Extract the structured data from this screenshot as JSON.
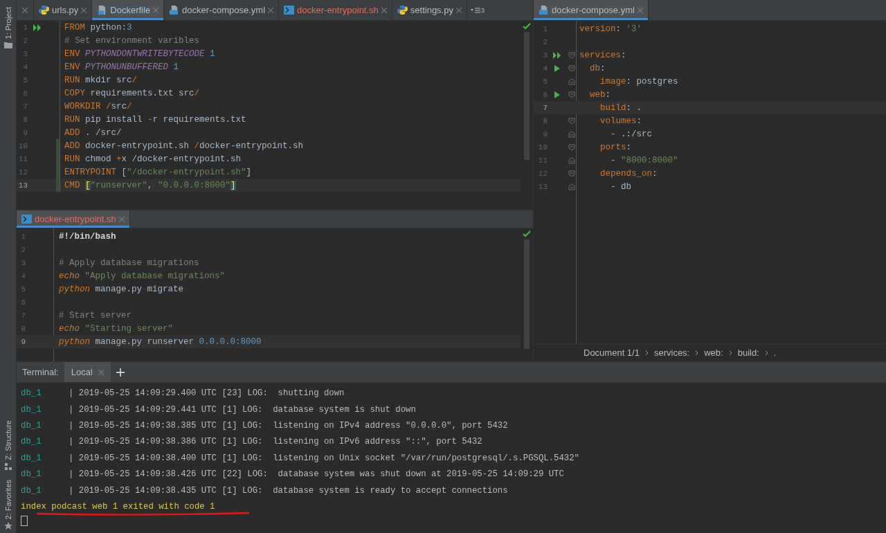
{
  "sidebar": {
    "top": [
      {
        "label": "1: Project"
      }
    ],
    "bottom": [
      {
        "label": "Z: Structure"
      },
      {
        "label": "2: Favorites"
      }
    ]
  },
  "editors": [
    {
      "kind": "dockerfile",
      "tabs": [
        {
          "label": "urls.py",
          "kind": "python",
          "selected": false,
          "error": false
        },
        {
          "label": "Dockerfile",
          "kind": "docker",
          "selected": true,
          "error": false
        },
        {
          "label": "docker-compose.yml",
          "kind": "compose",
          "selected": false,
          "error": false
        },
        {
          "label": "docker-entrypoint.sh",
          "kind": "shell",
          "selected": false,
          "error": true
        },
        {
          "label": "settings.py",
          "kind": "python",
          "selected": false,
          "error": false
        }
      ],
      "hidden_tab_count": "3",
      "lines": [
        {
          "n": "1",
          "run_all": true,
          "changed": false,
          "current": false,
          "tokens": [
            {
              "kind": "kw",
              "text": "FROM"
            },
            {
              "kind": "plain",
              "text": " python:"
            },
            {
              "kind": "num",
              "text": "3"
            }
          ]
        },
        {
          "n": "2",
          "run_all": false,
          "changed": false,
          "current": false,
          "tokens": [
            {
              "kind": "comment",
              "text": "# Set environment varibles"
            }
          ]
        },
        {
          "n": "3",
          "run_all": false,
          "changed": false,
          "current": false,
          "tokens": [
            {
              "kind": "kw",
              "text": "ENV "
            },
            {
              "kind": "var",
              "text": "PYTHONDONTWRITEBYTECODE"
            },
            {
              "kind": "num",
              "text": " 1"
            }
          ]
        },
        {
          "n": "4",
          "run_all": false,
          "changed": false,
          "current": false,
          "tokens": [
            {
              "kind": "kw",
              "text": "ENV "
            },
            {
              "kind": "var",
              "text": "PYTHONUNBUFFERED"
            },
            {
              "kind": "num",
              "text": " 1"
            }
          ]
        },
        {
          "n": "5",
          "run_all": false,
          "changed": false,
          "current": false,
          "tokens": [
            {
              "kind": "kw",
              "text": "RUN"
            },
            {
              "kind": "plain",
              "text": " mkdir src"
            },
            {
              "kind": "kw",
              "text": "/"
            }
          ]
        },
        {
          "n": "6",
          "run_all": false,
          "changed": false,
          "current": false,
          "tokens": [
            {
              "kind": "kw",
              "text": "COPY"
            },
            {
              "kind": "plain",
              "text": " requirements.txt src"
            },
            {
              "kind": "kw",
              "text": "/"
            }
          ]
        },
        {
          "n": "7",
          "run_all": false,
          "changed": false,
          "current": false,
          "tokens": [
            {
              "kind": "kw",
              "text": "WORKDIR /"
            },
            {
              "kind": "plain",
              "text": "src"
            },
            {
              "kind": "kw",
              "text": "/"
            }
          ]
        },
        {
          "n": "8",
          "run_all": false,
          "changed": false,
          "current": false,
          "tokens": [
            {
              "kind": "kw",
              "text": "RUN"
            },
            {
              "kind": "plain",
              "text": " pip install "
            },
            {
              "kind": "kw",
              "text": "-"
            },
            {
              "kind": "plain",
              "text": "r requirements.txt"
            }
          ]
        },
        {
          "n": "9",
          "run_all": false,
          "changed": false,
          "current": false,
          "tokens": [
            {
              "kind": "kw",
              "text": "ADD"
            },
            {
              "kind": "plain",
              "text": " . /src/"
            }
          ]
        },
        {
          "n": "10",
          "run_all": false,
          "changed": true,
          "current": false,
          "tokens": [
            {
              "kind": "kw",
              "text": "ADD"
            },
            {
              "kind": "plain",
              "text": " docker-entrypoint.sh "
            },
            {
              "kind": "kw",
              "text": "/"
            },
            {
              "kind": "plain",
              "text": "docker-entrypoint.sh"
            }
          ]
        },
        {
          "n": "11",
          "run_all": false,
          "changed": true,
          "current": false,
          "tokens": [
            {
              "kind": "kw",
              "text": "RUN"
            },
            {
              "kind": "plain",
              "text": " chmod "
            },
            {
              "kind": "kw",
              "text": "+"
            },
            {
              "kind": "plain",
              "text": "x /docker-entrypoint.sh"
            }
          ]
        },
        {
          "n": "12",
          "run_all": false,
          "changed": true,
          "current": false,
          "tokens": [
            {
              "kind": "kw",
              "text": "ENTRYPOINT"
            },
            {
              "kind": "plain",
              "text": " ["
            },
            {
              "kind": "str",
              "text": "\"/docker-entrypoint.sh\""
            },
            {
              "kind": "plain",
              "text": "]"
            }
          ]
        },
        {
          "n": "13",
          "run_all": false,
          "changed": true,
          "current": true,
          "tokens": [
            {
              "kind": "kw",
              "text": "CMD "
            },
            {
              "kind": "bracket",
              "text": "["
            },
            {
              "kind": "str",
              "text": "\"runserver\""
            },
            {
              "kind": "plain",
              "text": ", "
            },
            {
              "kind": "str",
              "text": "\"0.0.0.0:8000\""
            },
            {
              "kind": "bracket",
              "text": "]"
            }
          ]
        }
      ]
    },
    {
      "kind": "shell",
      "tabs": [
        {
          "label": "docker-entrypoint.sh",
          "kind": "shell",
          "selected": true,
          "error": true
        }
      ],
      "lines": [
        {
          "n": "1",
          "current": false,
          "tokens": [
            {
              "kind": "shebang",
              "text": "#!/bin/bash"
            }
          ]
        },
        {
          "n": "2",
          "current": false
        },
        {
          "n": "3",
          "current": false,
          "tokens": [
            {
              "kind": "comment",
              "text": "# Apply database migrations"
            }
          ]
        },
        {
          "n": "4",
          "current": false,
          "tokens": [
            {
              "kind": "ikw",
              "text": "echo"
            },
            {
              "kind": "str",
              "text": " \"Apply database migrations\""
            }
          ]
        },
        {
          "n": "5",
          "current": false,
          "tokens": [
            {
              "kind": "ikw",
              "text": "python"
            },
            {
              "kind": "plain",
              "text": " manage.py migrate"
            }
          ]
        },
        {
          "n": "6",
          "current": false
        },
        {
          "n": "7",
          "current": false,
          "tokens": [
            {
              "kind": "comment",
              "text": "# Start server"
            }
          ]
        },
        {
          "n": "8",
          "current": false,
          "tokens": [
            {
              "kind": "ikw",
              "text": "echo"
            },
            {
              "kind": "str",
              "text": " \"Starting server\""
            }
          ]
        },
        {
          "n": "9",
          "current": true,
          "tokens": [
            {
              "kind": "ikw",
              "text": "python"
            },
            {
              "kind": "plain",
              "text": " manage.py runserver "
            },
            {
              "kind": "num",
              "text": "0.0.0.0:8000"
            }
          ]
        }
      ]
    },
    {
      "kind": "yaml",
      "tabs": [
        {
          "label": "docker-compose.yml",
          "kind": "compose",
          "selected": true,
          "error": false
        }
      ],
      "lines": [
        {
          "n": "1",
          "run_all": false,
          "run": false,
          "fold_start": false,
          "fold_end": false,
          "current": false,
          "tokens": [
            {
              "kind": "kw",
              "text": "version"
            },
            {
              "kind": "plain",
              "text": ": "
            },
            {
              "kind": "str",
              "text": "'3'"
            }
          ]
        },
        {
          "n": "2",
          "run_all": false,
          "run": false,
          "fold_start": false,
          "fold_end": false,
          "current": false
        },
        {
          "n": "3",
          "run_all": true,
          "run": false,
          "fold_start": true,
          "fold_end": false,
          "current": false,
          "tokens": [
            {
              "kind": "kw",
              "text": "services"
            },
            {
              "kind": "plain",
              "text": ":"
            }
          ]
        },
        {
          "n": "4",
          "run_all": false,
          "run": true,
          "fold_start": true,
          "fold_end": false,
          "current": false,
          "tokens": [
            {
              "kind": "kw",
              "text": "  db"
            },
            {
              "kind": "plain",
              "text": ":"
            }
          ]
        },
        {
          "n": "5",
          "run_all": false,
          "run": false,
          "fold_start": false,
          "fold_end": true,
          "current": false,
          "tokens": [
            {
              "kind": "kw",
              "text": "    image"
            },
            {
              "kind": "plain",
              "text": ": postgres"
            }
          ]
        },
        {
          "n": "6",
          "run_all": false,
          "run": true,
          "fold_start": true,
          "fold_end": false,
          "current": false,
          "tokens": [
            {
              "kind": "kw",
              "text": "  web"
            },
            {
              "kind": "plain",
              "text": ":"
            }
          ]
        },
        {
          "n": "7",
          "run_all": false,
          "run": false,
          "fold_start": false,
          "fold_end": false,
          "current": true,
          "tokens": [
            {
              "kind": "kw",
              "text": "    build"
            },
            {
              "kind": "plain",
              "text": ": ."
            }
          ]
        },
        {
          "n": "8",
          "run_all": false,
          "run": false,
          "fold_start": true,
          "fold_end": false,
          "current": false,
          "tokens": [
            {
              "kind": "kw",
              "text": "    volumes"
            },
            {
              "kind": "plain",
              "text": ":"
            }
          ]
        },
        {
          "n": "9",
          "run_all": false,
          "run": false,
          "fold_start": false,
          "fold_end": true,
          "current": false,
          "tokens": [
            {
              "kind": "plain",
              "text": "      - .:/src"
            }
          ]
        },
        {
          "n": "10",
          "run_all": false,
          "run": false,
          "fold_start": true,
          "fold_end": false,
          "current": false,
          "tokens": [
            {
              "kind": "kw",
              "text": "    ports"
            },
            {
              "kind": "plain",
              "text": ":"
            }
          ]
        },
        {
          "n": "11",
          "run_all": false,
          "run": false,
          "fold_start": false,
          "fold_end": true,
          "current": false,
          "tokens": [
            {
              "kind": "plain",
              "text": "      - "
            },
            {
              "kind": "str",
              "text": "\"8000:8000\""
            }
          ]
        },
        {
          "n": "12",
          "run_all": false,
          "run": false,
          "fold_start": true,
          "fold_end": false,
          "current": false,
          "tokens": [
            {
              "kind": "kw",
              "text": "    depends_on"
            },
            {
              "kind": "plain",
              "text": ":"
            }
          ]
        },
        {
          "n": "13",
          "run_all": false,
          "run": false,
          "fold_start": false,
          "fold_end": true,
          "current": false,
          "tokens": [
            {
              "kind": "plain",
              "text": "      - db"
            }
          ]
        }
      ],
      "breadcrumbs": [
        "Document 1/1",
        "services:",
        "web:",
        "build:",
        "."
      ]
    }
  ],
  "terminal": {
    "title": "Terminal:",
    "tabs": [
      {
        "label": "Local",
        "selected": true
      }
    ],
    "lines": [
      {
        "kind": "log",
        "service": "db_1",
        "text": "| 2019-05-25 14:09:29.400 UTC [23] LOG:  shutting down"
      },
      {
        "kind": "log",
        "service": "db_1",
        "text": "| 2019-05-25 14:09:29.441 UTC [1] LOG:  database system is shut down"
      },
      {
        "kind": "log",
        "service": "db_1",
        "text": "| 2019-05-25 14:09:38.385 UTC [1] LOG:  listening on IPv4 address \"0.0.0.0\", port 5432"
      },
      {
        "kind": "log",
        "service": "db_1",
        "text": "| 2019-05-25 14:09:38.386 UTC [1] LOG:  listening on IPv6 address \"::\", port 5432"
      },
      {
        "kind": "log",
        "service": "db_1",
        "text": "| 2019-05-25 14:09:38.400 UTC [1] LOG:  listening on Unix socket \"/var/run/postgresql/.s.PGSQL.5432\""
      },
      {
        "kind": "log",
        "service": "db_1",
        "text": "| 2019-05-25 14:09:38.426 UTC [22] LOG:  database system was shut down at 2019-05-25 14:09:29 UTC"
      },
      {
        "kind": "log",
        "service": "db_1",
        "text": "| 2019-05-25 14:09:38.435 UTC [1] LOG:  database system is ready to accept connections"
      },
      {
        "kind": "status",
        "text": "index podcast web 1 exited with code 1",
        "underlined": true
      }
    ]
  }
}
